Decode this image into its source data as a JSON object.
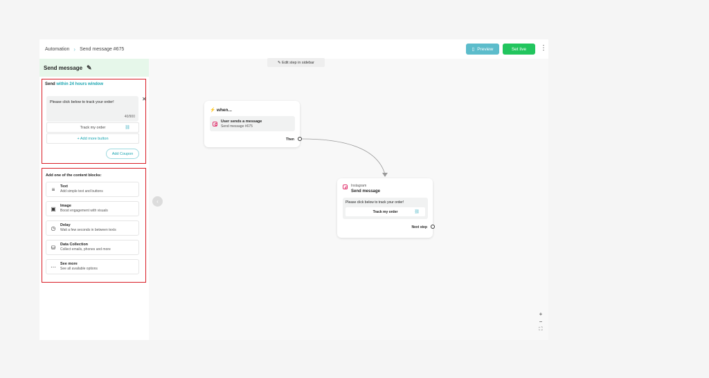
{
  "topbar": {
    "breadcrumb_root": "Automation",
    "breadcrumb_current": "Send message #675",
    "preview_label": "Preview",
    "set_live_label": "Set live"
  },
  "sidebar": {
    "title": "Send message",
    "send_prefix": "Send",
    "send_window_link": "within 24 hours window",
    "message_text": "Please click below to track your order!",
    "char_counter": "40/900",
    "button_label": "Track my order",
    "add_more_label": "+ Add more button",
    "add_coupon_label": "Add Coupon",
    "blocks_title": "Add one of the content blocks:",
    "blocks": [
      {
        "title": "Text",
        "subtitle": "Add simple text and buttons",
        "icon": "text-lines-icon"
      },
      {
        "title": "Image",
        "subtitle": "Boost engagement with visuals",
        "icon": "image-icon"
      },
      {
        "title": "Delay",
        "subtitle": "Wait a few seconds in between texts",
        "icon": "clock-icon"
      },
      {
        "title": "Data Collection",
        "subtitle": "Collect emails, phones and more",
        "icon": "database-icon"
      },
      {
        "title": "See more",
        "subtitle": "See all available options",
        "icon": "ellipsis-icon"
      }
    ]
  },
  "canvas": {
    "edit_hint": "✎ Edit step in sidebar",
    "trigger_node": {
      "when_label": "when...",
      "trigger_title": "User sends a message",
      "trigger_subtitle": "Send message #675",
      "then_label": "Then"
    },
    "action_node": {
      "platform_label": "Instagram",
      "title": "Send message",
      "message_text": "Please click below to track your order!",
      "button_label": "Track my order",
      "next_step_label": "Next step"
    },
    "zoom": {
      "zoom_in": "+",
      "zoom_out": "−",
      "fit": "⛶"
    }
  },
  "colors": {
    "accent": "#18a4b0",
    "preview_button": "#5cbccb",
    "live_button": "#22c55e",
    "highlight_box": "#d81b23",
    "sidebar_header_bg": "#e6f7ea"
  }
}
